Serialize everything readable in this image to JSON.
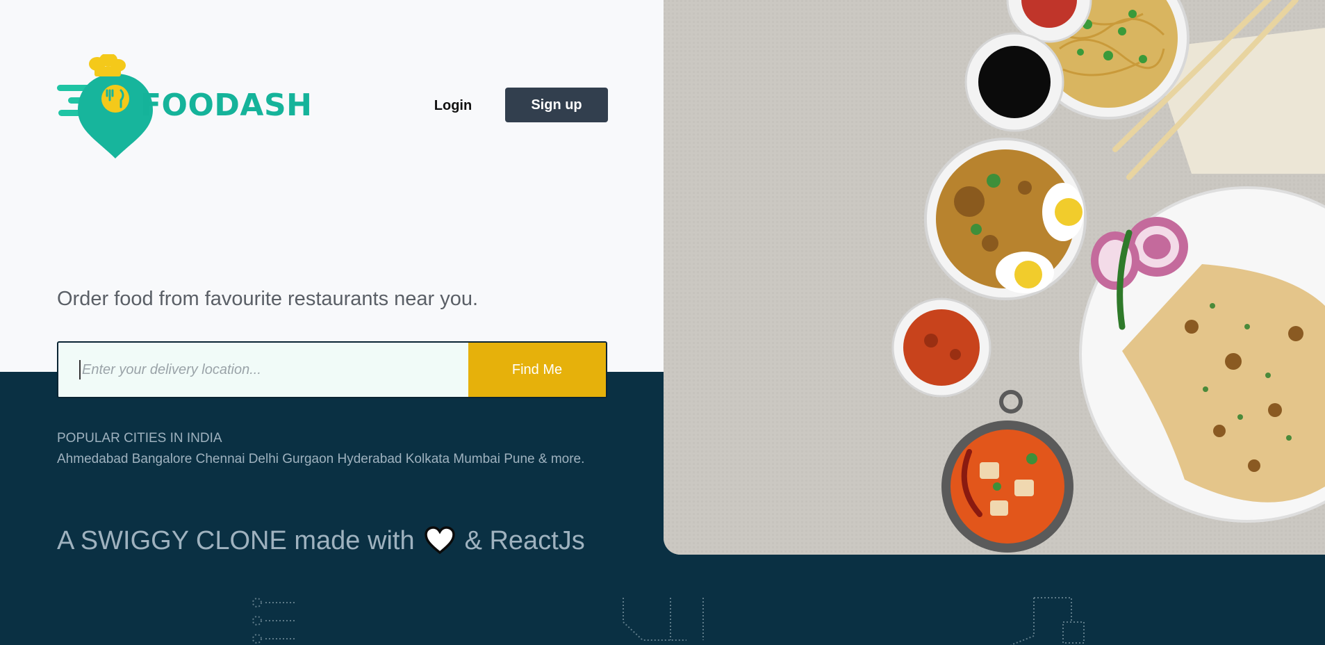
{
  "brand": {
    "name": "FOODASH"
  },
  "header": {
    "login_label": "Login",
    "signup_label": "Sign up"
  },
  "hero": {
    "tagline": "Order food from favourite restaurants near you.",
    "search_placeholder": "Enter your delivery location...",
    "search_value": "",
    "find_button": "Find Me"
  },
  "cities": {
    "label": "POPULAR CITIES IN INDIA",
    "list": "Ahmedabad Bangalore Chennai Delhi Gurgaon Hyderabad Kolkata Mumbai Pune & more."
  },
  "footer_note": {
    "prefix": "A SWIGGY CLONE made with",
    "suffix": "& ReactJs",
    "icon": "heart-icon"
  },
  "colors": {
    "brand": "#15b39a",
    "navy": "#0a3043",
    "button_dark": "#323f4e",
    "accent_yellow": "#e6b10b",
    "muted_text": "#9fb2bf"
  },
  "icons": [
    "chef-hat-icon",
    "location-pin-icon",
    "heart-icon",
    "list-icon",
    "building-icon",
    "cart-icon"
  ]
}
